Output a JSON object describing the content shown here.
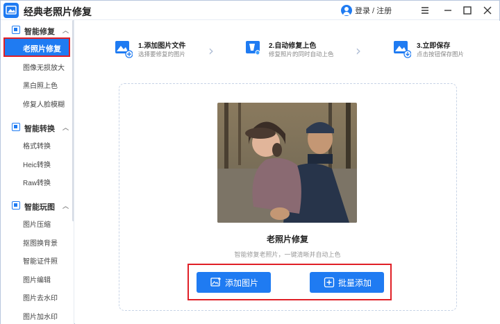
{
  "app": {
    "title": "经典老照片修复",
    "login_label": "登录 / 注册"
  },
  "window_controls": [
    "menu-icon",
    "minimize-icon",
    "maximize-icon",
    "close-icon"
  ],
  "sidebar": {
    "groups": [
      {
        "label": "智能修复",
        "items": [
          "老照片修复",
          "图像无损放大",
          "黑白照上色",
          "修复人脸模糊"
        ]
      },
      {
        "label": "智能转换",
        "items": [
          "格式转换",
          "Heic转换",
          "Raw转换"
        ]
      },
      {
        "label": "智能玩图",
        "items": [
          "图片压缩",
          "抠图换背景",
          "智能证件照",
          "图片编辑",
          "图片去水印",
          "图片加水印"
        ]
      }
    ],
    "active_item": "老照片修复"
  },
  "steps": [
    {
      "title": "1.添加图片文件",
      "desc": "选择要修复的图片",
      "icon": "image-add-icon"
    },
    {
      "title": "2.自动修复上色",
      "desc": "修复照片的同时自动上色",
      "icon": "paint-bucket-icon"
    },
    {
      "title": "3.立即保存",
      "desc": "点击按钮保存图片",
      "icon": "image-save-icon"
    }
  ],
  "main": {
    "title": "老照片修复",
    "subtitle": "智能修复老照片，一键清晰并自动上色",
    "add_button": "添加图片",
    "batch_button": "批量添加"
  },
  "colors": {
    "accent": "#1f7bf2",
    "highlight": "#e01f26"
  }
}
